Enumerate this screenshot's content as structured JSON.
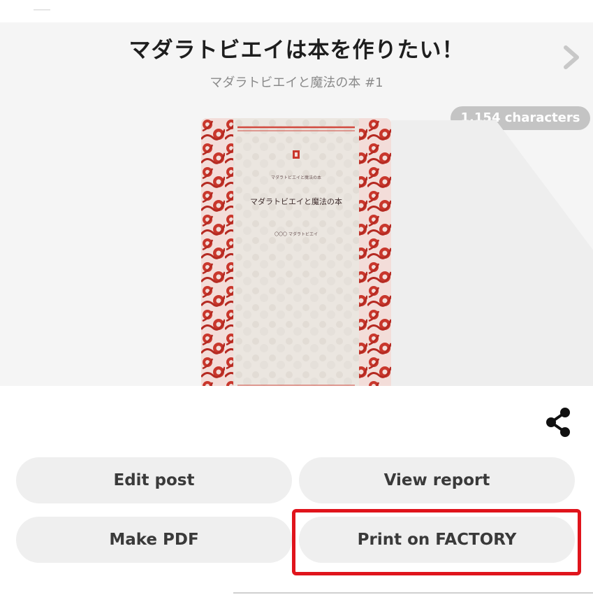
{
  "work": {
    "title": "マダラトビエイは本を作りたい！",
    "series": "マダラトビエイと魔法の本 #1",
    "char_count": "1,154 characters"
  },
  "cover": {
    "series_small": "マダラトビエイと魔法の本",
    "title": "マダラトビエイと魔法の本",
    "author": "〇〇〇 マダラトビエイ"
  },
  "actions": {
    "edit_post": "Edit post",
    "view_report": "View report",
    "make_pdf": "Make PDF",
    "print_factory": "Print on FACTORY"
  },
  "icons": {
    "next": "chevron-right-icon",
    "share": "share-icon"
  },
  "colors": {
    "highlight": "#e0141c",
    "cover_pattern": "#c9372c",
    "button_bg": "#efefef",
    "badge_bg": "#c4c4c4"
  }
}
